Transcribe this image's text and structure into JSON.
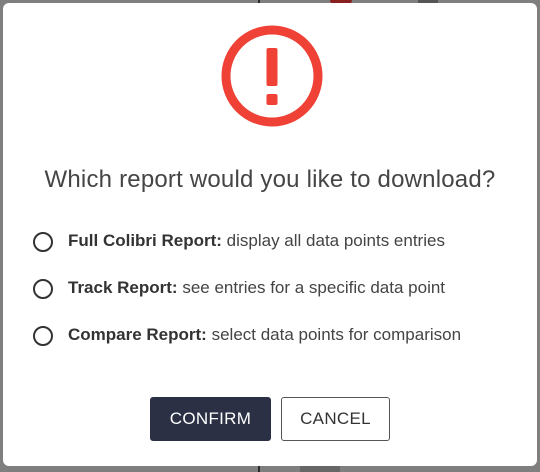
{
  "dialog": {
    "title": "Which report would you like to download?",
    "icon": "exclamation-circle-icon",
    "accent_color": "#ef4136",
    "options": [
      {
        "label": "Full Colibri Report:",
        "description": " display all data points entries",
        "selected": false
      },
      {
        "label": "Track Report:",
        "description": " see entries for a specific data point",
        "selected": false
      },
      {
        "label": "Compare Report:",
        "description": " select data points for comparison",
        "selected": false
      }
    ],
    "confirm_label": "CONFIRM",
    "cancel_label": "CANCEL",
    "confirm_color": "#2b3044"
  }
}
